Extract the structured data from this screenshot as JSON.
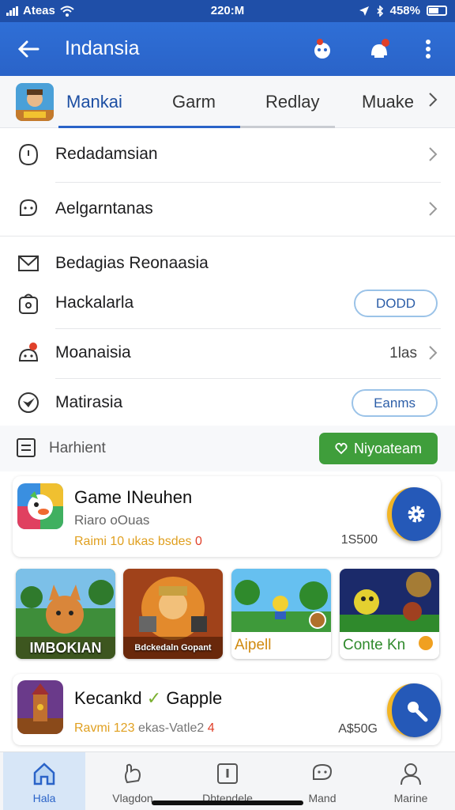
{
  "status_bar": {
    "carrier": "Ateas",
    "time": "220:M",
    "battery": "458%"
  },
  "app_bar": {
    "title": "Indansia"
  },
  "tabs": [
    {
      "label": "Mankai",
      "active": true
    },
    {
      "label": "Garm",
      "active": false
    },
    {
      "label": "Redlay",
      "active": false
    },
    {
      "label": "Muake",
      "active": false
    }
  ],
  "menu_group_1": [
    {
      "label": "Redadamsian",
      "icon": "clock-icon"
    },
    {
      "label": "Aelgarntanas",
      "icon": "chat-bubble-icon"
    }
  ],
  "menu_group_2": {
    "header": "Bedagias Reonaasia",
    "items": [
      {
        "label": "Hackalarla",
        "pill": "DODD"
      },
      {
        "label": "Moanaisia",
        "trailing": "1las"
      },
      {
        "label": "Matirasia",
        "pill": "Eanms"
      }
    ]
  },
  "section_bar": {
    "label": "Harhient",
    "button": "Niyoateam"
  },
  "cards": [
    {
      "name": "Game INeuhen",
      "subtitle": "Riaro oOuas",
      "meta": "Raimi 10 ukas bsdes",
      "meta_red": "0",
      "price": "1S500"
    },
    {
      "name": "Kecankd",
      "name_suffix": "Gapple",
      "meta": "Ravmi 123",
      "meta_gray": "ekas-Vatle2",
      "meta_red": "4",
      "price": "A$50G"
    }
  ],
  "tiles": [
    {
      "caption": "IMBOKIAN"
    },
    {
      "caption": "Bdckedaln Gopant"
    },
    {
      "caption": "Aipell"
    },
    {
      "caption": "Conte Kn"
    }
  ],
  "bottom_nav": [
    {
      "label": "Hala",
      "active": true
    },
    {
      "label": "Vlagdon",
      "active": false
    },
    {
      "label": "Dhtendele",
      "active": false
    },
    {
      "label": "Mand",
      "active": false
    },
    {
      "label": "Marine",
      "active": false
    }
  ],
  "colors": {
    "primary": "#2a63c8",
    "accent_green": "#3f9e3b",
    "accent_yellow": "#f2b526"
  }
}
